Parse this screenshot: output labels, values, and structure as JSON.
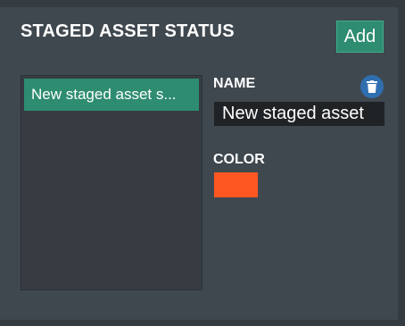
{
  "header": {
    "title": "STAGED ASSET STATUS",
    "add_label": "Add"
  },
  "list": {
    "items": [
      {
        "label": "New staged asset s..."
      }
    ]
  },
  "detail": {
    "name_label": "NAME",
    "name_value": "New staged asset",
    "color_label": "COLOR",
    "color_value": "#ff5722",
    "delete_icon": "trash-icon"
  },
  "colors": {
    "accent": "#2e8c71",
    "delete": "#2f6fb0",
    "panel": "#3f484f",
    "list_bg": "#363c42"
  }
}
